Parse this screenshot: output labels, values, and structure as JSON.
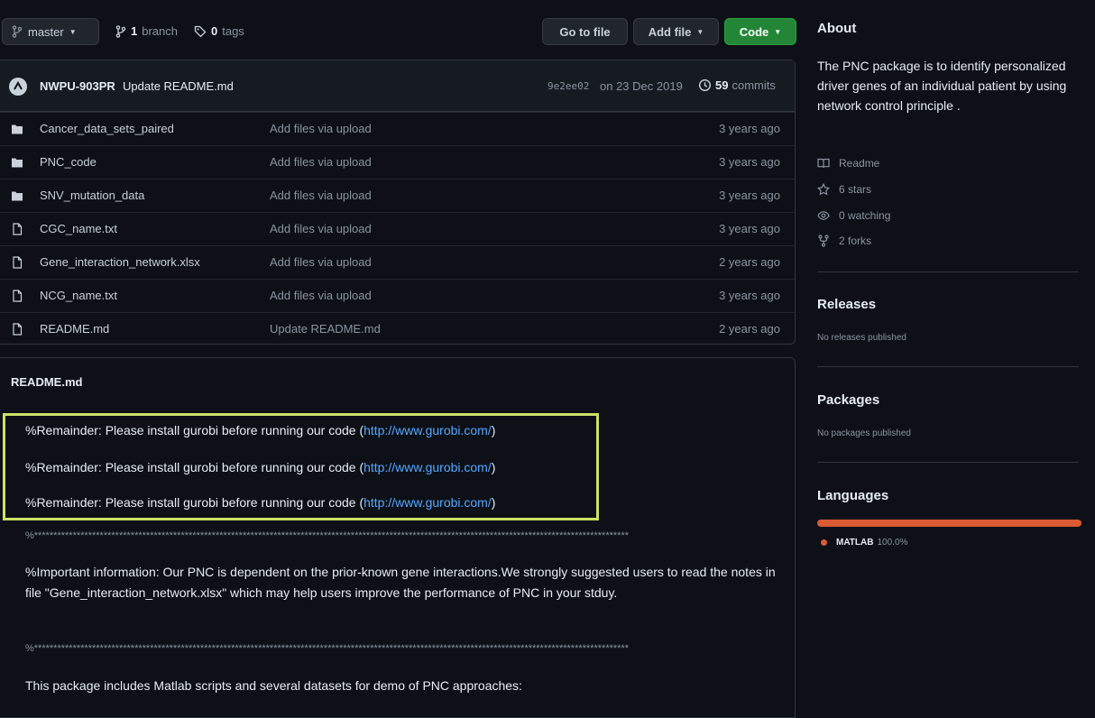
{
  "top": {
    "branch": "master",
    "branch_count": "1",
    "branch_word": "branch",
    "tag_count": "0",
    "tag_word": "tags",
    "go_to_file": "Go to file",
    "add_file": "Add file",
    "code": "Code"
  },
  "commit": {
    "author": "NWPU-903PR",
    "message": "Update README.md",
    "sha": "9e2ee02",
    "date": "on 23 Dec 2019",
    "count": "59",
    "count_word": "commits"
  },
  "files": [
    {
      "type": "folder",
      "name": "Cancer_data_sets_paired",
      "message": "Add files via upload",
      "age": "3 years ago"
    },
    {
      "type": "folder",
      "name": "PNC_code",
      "message": "Add files via upload",
      "age": "3 years ago"
    },
    {
      "type": "folder",
      "name": "SNV_mutation_data",
      "message": "Add files via upload",
      "age": "3 years ago"
    },
    {
      "type": "file",
      "name": "CGC_name.txt",
      "message": "Add files via upload",
      "age": "3 years ago"
    },
    {
      "type": "file",
      "name": "Gene_interaction_network.xlsx",
      "message": "Add files via upload",
      "age": "2 years ago"
    },
    {
      "type": "file",
      "name": "NCG_name.txt",
      "message": "Add files via upload",
      "age": "3 years ago"
    },
    {
      "type": "file",
      "name": "README.md",
      "message": "Update README.md",
      "age": "2 years ago"
    }
  ],
  "readme": {
    "title": "README.md",
    "reminder_text": "%Remainder: Please install gurobi before running our code (",
    "reminder_link": "http://www.gurobi.com/",
    "reminder_close": ")",
    "stars": "%**********************************************************************************************************************************************************",
    "important": "%Important information: Our PNC is dependent on the prior-known gene interactions.We strongly suggested users to read the notes in file \"Gene_interaction_network.xlsx\" which may help users improve the performance of PNC in your stduy.",
    "package_line": "This package includes Matlab scripts and several datasets for demo of PNC approaches:"
  },
  "about": {
    "title": "About",
    "description": "The PNC package is to identify personalized driver genes of an individual patient by using network control principle .",
    "readme": "Readme",
    "stars": "6 stars",
    "watching": "0 watching",
    "forks": "2 forks"
  },
  "releases": {
    "title": "Releases",
    "note": "No releases published"
  },
  "packages": {
    "title": "Packages",
    "note": "No packages published"
  },
  "languages": {
    "title": "Languages",
    "items": [
      {
        "name": "MATLAB",
        "percent": "100.0%",
        "color": "#da5b34"
      }
    ]
  }
}
